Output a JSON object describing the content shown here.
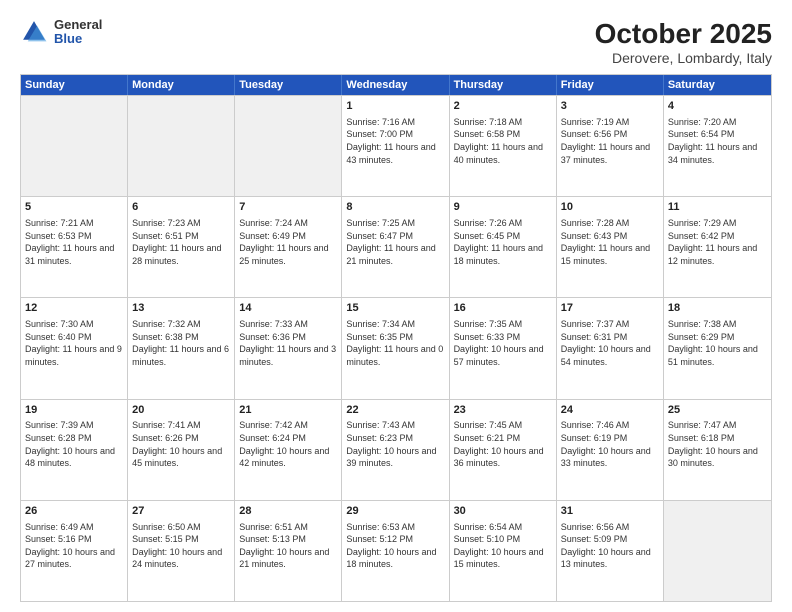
{
  "logo": {
    "general": "General",
    "blue": "Blue"
  },
  "title": "October 2025",
  "subtitle": "Derovere, Lombardy, Italy",
  "days": [
    "Sunday",
    "Monday",
    "Tuesday",
    "Wednesday",
    "Thursday",
    "Friday",
    "Saturday"
  ],
  "weeks": [
    [
      {
        "day": "",
        "info": ""
      },
      {
        "day": "",
        "info": ""
      },
      {
        "day": "",
        "info": ""
      },
      {
        "day": "1",
        "info": "Sunrise: 7:16 AM\nSunset: 7:00 PM\nDaylight: 11 hours and 43 minutes."
      },
      {
        "day": "2",
        "info": "Sunrise: 7:18 AM\nSunset: 6:58 PM\nDaylight: 11 hours and 40 minutes."
      },
      {
        "day": "3",
        "info": "Sunrise: 7:19 AM\nSunset: 6:56 PM\nDaylight: 11 hours and 37 minutes."
      },
      {
        "day": "4",
        "info": "Sunrise: 7:20 AM\nSunset: 6:54 PM\nDaylight: 11 hours and 34 minutes."
      }
    ],
    [
      {
        "day": "5",
        "info": "Sunrise: 7:21 AM\nSunset: 6:53 PM\nDaylight: 11 hours and 31 minutes."
      },
      {
        "day": "6",
        "info": "Sunrise: 7:23 AM\nSunset: 6:51 PM\nDaylight: 11 hours and 28 minutes."
      },
      {
        "day": "7",
        "info": "Sunrise: 7:24 AM\nSunset: 6:49 PM\nDaylight: 11 hours and 25 minutes."
      },
      {
        "day": "8",
        "info": "Sunrise: 7:25 AM\nSunset: 6:47 PM\nDaylight: 11 hours and 21 minutes."
      },
      {
        "day": "9",
        "info": "Sunrise: 7:26 AM\nSunset: 6:45 PM\nDaylight: 11 hours and 18 minutes."
      },
      {
        "day": "10",
        "info": "Sunrise: 7:28 AM\nSunset: 6:43 PM\nDaylight: 11 hours and 15 minutes."
      },
      {
        "day": "11",
        "info": "Sunrise: 7:29 AM\nSunset: 6:42 PM\nDaylight: 11 hours and 12 minutes."
      }
    ],
    [
      {
        "day": "12",
        "info": "Sunrise: 7:30 AM\nSunset: 6:40 PM\nDaylight: 11 hours and 9 minutes."
      },
      {
        "day": "13",
        "info": "Sunrise: 7:32 AM\nSunset: 6:38 PM\nDaylight: 11 hours and 6 minutes."
      },
      {
        "day": "14",
        "info": "Sunrise: 7:33 AM\nSunset: 6:36 PM\nDaylight: 11 hours and 3 minutes."
      },
      {
        "day": "15",
        "info": "Sunrise: 7:34 AM\nSunset: 6:35 PM\nDaylight: 11 hours and 0 minutes."
      },
      {
        "day": "16",
        "info": "Sunrise: 7:35 AM\nSunset: 6:33 PM\nDaylight: 10 hours and 57 minutes."
      },
      {
        "day": "17",
        "info": "Sunrise: 7:37 AM\nSunset: 6:31 PM\nDaylight: 10 hours and 54 minutes."
      },
      {
        "day": "18",
        "info": "Sunrise: 7:38 AM\nSunset: 6:29 PM\nDaylight: 10 hours and 51 minutes."
      }
    ],
    [
      {
        "day": "19",
        "info": "Sunrise: 7:39 AM\nSunset: 6:28 PM\nDaylight: 10 hours and 48 minutes."
      },
      {
        "day": "20",
        "info": "Sunrise: 7:41 AM\nSunset: 6:26 PM\nDaylight: 10 hours and 45 minutes."
      },
      {
        "day": "21",
        "info": "Sunrise: 7:42 AM\nSunset: 6:24 PM\nDaylight: 10 hours and 42 minutes."
      },
      {
        "day": "22",
        "info": "Sunrise: 7:43 AM\nSunset: 6:23 PM\nDaylight: 10 hours and 39 minutes."
      },
      {
        "day": "23",
        "info": "Sunrise: 7:45 AM\nSunset: 6:21 PM\nDaylight: 10 hours and 36 minutes."
      },
      {
        "day": "24",
        "info": "Sunrise: 7:46 AM\nSunset: 6:19 PM\nDaylight: 10 hours and 33 minutes."
      },
      {
        "day": "25",
        "info": "Sunrise: 7:47 AM\nSunset: 6:18 PM\nDaylight: 10 hours and 30 minutes."
      }
    ],
    [
      {
        "day": "26",
        "info": "Sunrise: 6:49 AM\nSunset: 5:16 PM\nDaylight: 10 hours and 27 minutes."
      },
      {
        "day": "27",
        "info": "Sunrise: 6:50 AM\nSunset: 5:15 PM\nDaylight: 10 hours and 24 minutes."
      },
      {
        "day": "28",
        "info": "Sunrise: 6:51 AM\nSunset: 5:13 PM\nDaylight: 10 hours and 21 minutes."
      },
      {
        "day": "29",
        "info": "Sunrise: 6:53 AM\nSunset: 5:12 PM\nDaylight: 10 hours and 18 minutes."
      },
      {
        "day": "30",
        "info": "Sunrise: 6:54 AM\nSunset: 5:10 PM\nDaylight: 10 hours and 15 minutes."
      },
      {
        "day": "31",
        "info": "Sunrise: 6:56 AM\nSunset: 5:09 PM\nDaylight: 10 hours and 13 minutes."
      },
      {
        "day": "",
        "info": ""
      }
    ]
  ]
}
